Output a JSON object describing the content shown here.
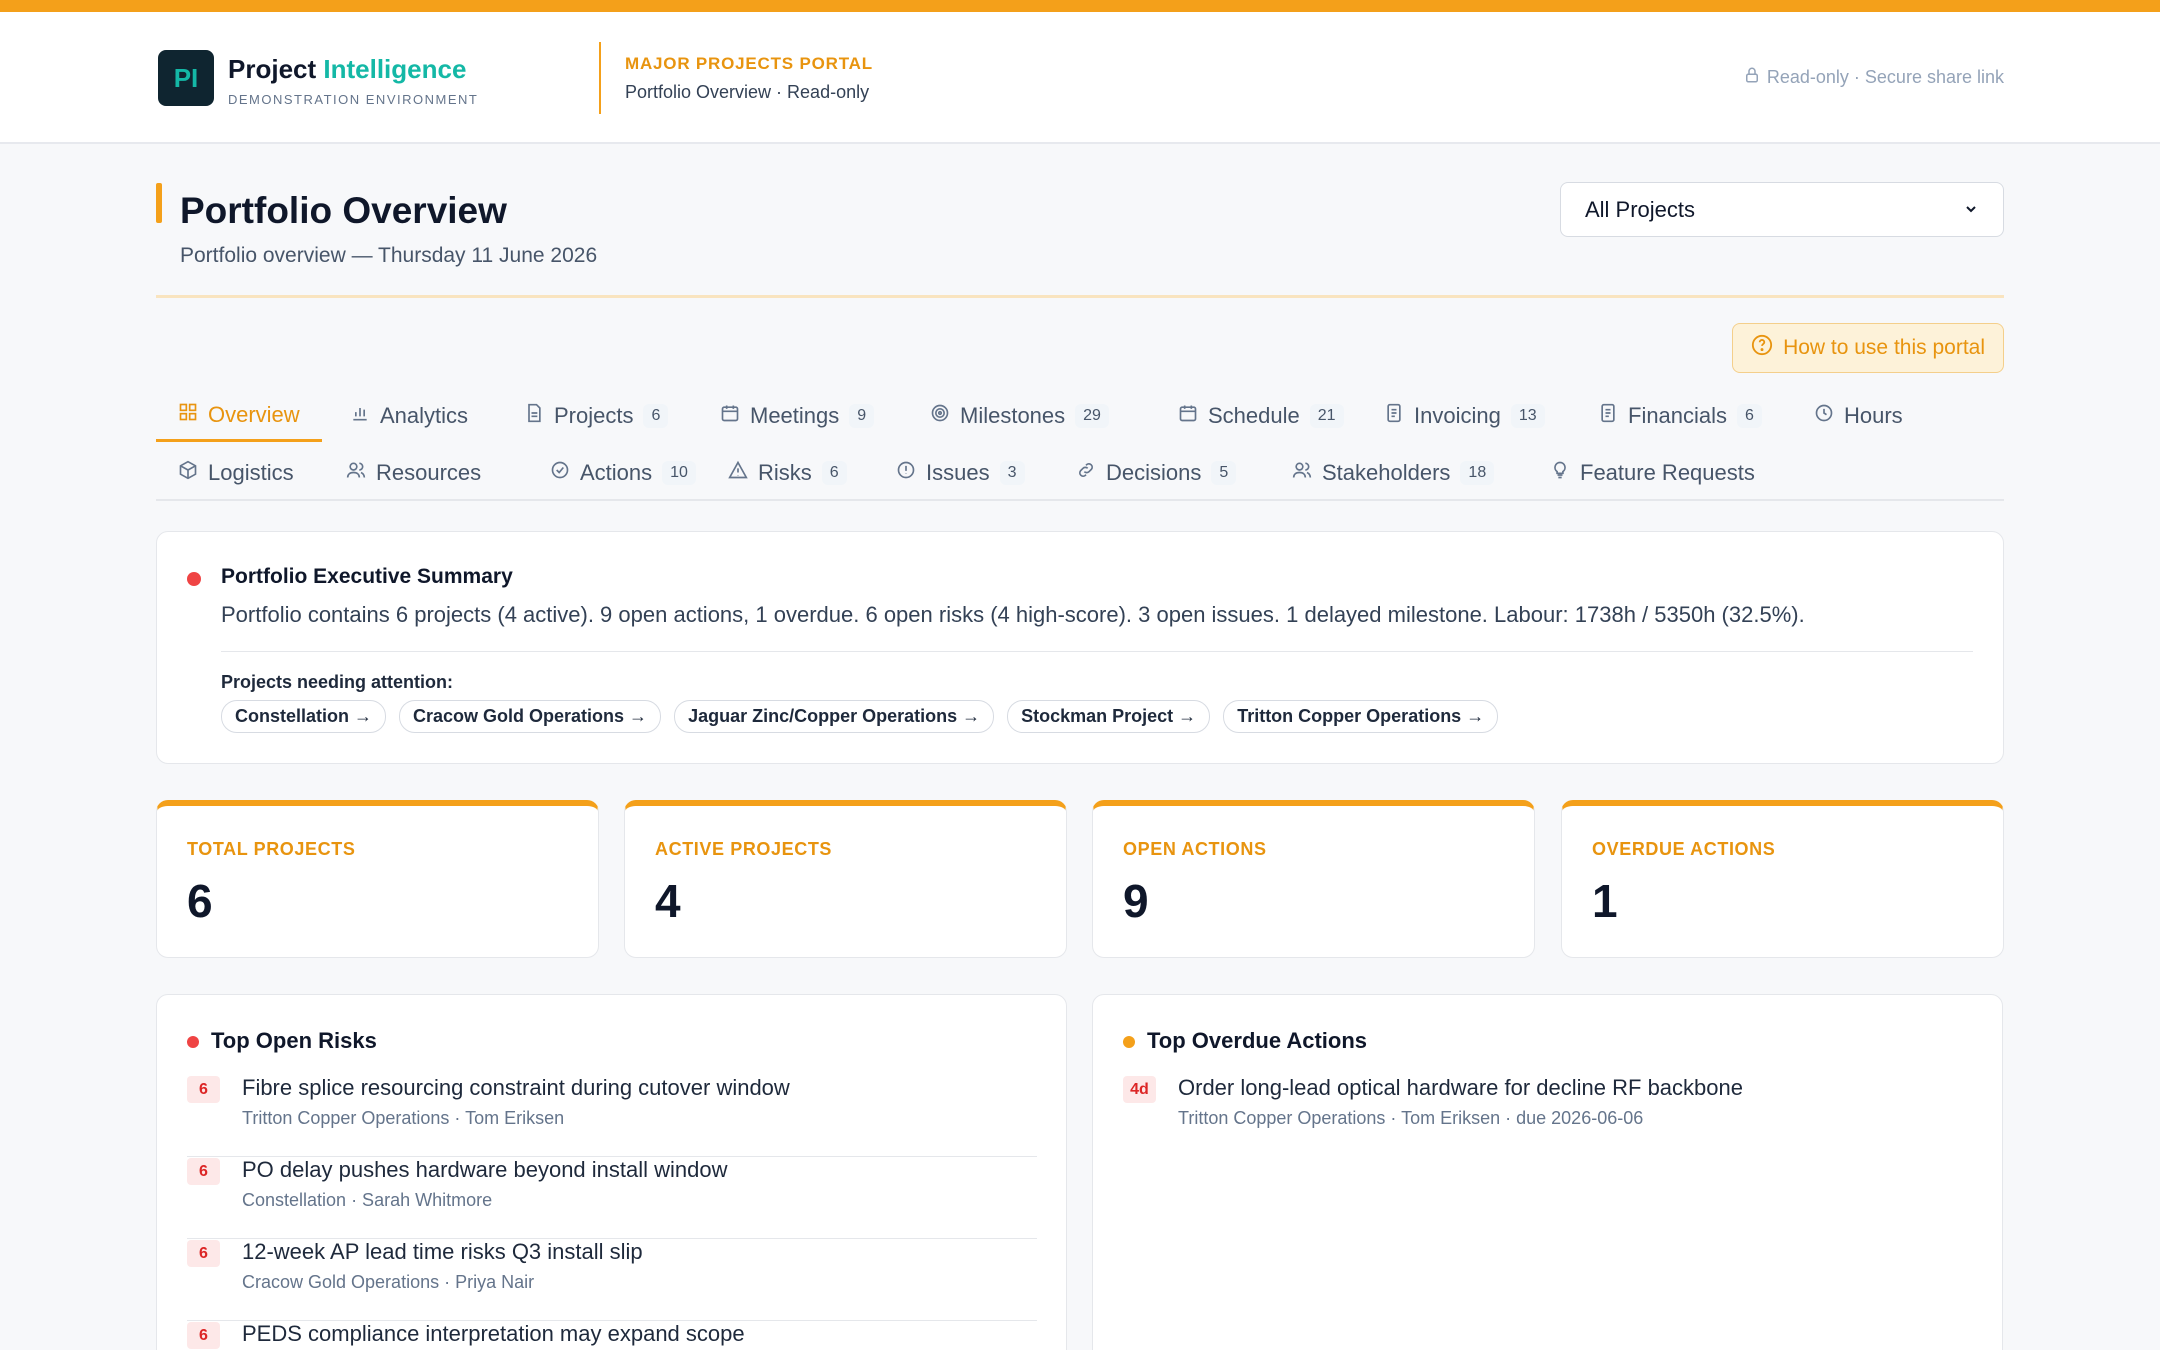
{
  "header": {
    "logo_initials": "PI",
    "brand_word1": "Project",
    "brand_word2": "Intelligence",
    "brand_subtitle": "DEMONSTRATION ENVIRONMENT",
    "portal_label": "MAJOR PROJECTS PORTAL",
    "portal_subtitle": "Portfolio Overview · Read-only",
    "share_text": "Read-only · Secure share link",
    "share_icon": "lock-icon"
  },
  "colors": {
    "accent": "#f4a01a",
    "brand_teal": "#14b8a6",
    "danger": "#ef4444"
  },
  "page": {
    "title": "Portfolio Overview",
    "subtitle": "Portfolio overview — Thursday 11 June 2026",
    "project_filter": "All Projects",
    "help_button": "How to use this portal"
  },
  "tabs_row1": [
    {
      "label": "Overview",
      "icon": "grid-icon",
      "count": "",
      "active": true
    },
    {
      "label": "Analytics",
      "icon": "bar-chart-icon",
      "count": ""
    },
    {
      "label": "Projects",
      "icon": "document-icon",
      "count": "6"
    },
    {
      "label": "Meetings",
      "icon": "calendar-icon",
      "count": "9"
    },
    {
      "label": "Milestones",
      "icon": "target-icon",
      "count": "29"
    },
    {
      "label": "Schedule",
      "icon": "calendar-icon",
      "count": "21"
    },
    {
      "label": "Invoicing",
      "icon": "receipt-icon",
      "count": "13"
    },
    {
      "label": "Financials",
      "icon": "receipt-icon",
      "count": "6"
    },
    {
      "label": "Hours",
      "icon": "clock-icon",
      "count": ""
    }
  ],
  "tabs_row2": [
    {
      "label": "Logistics",
      "icon": "box-icon",
      "count": ""
    },
    {
      "label": "Resources",
      "icon": "users-icon",
      "count": ""
    },
    {
      "label": "Actions",
      "icon": "check-circle-icon",
      "count": "10"
    },
    {
      "label": "Risks",
      "icon": "warning-icon",
      "count": "6"
    },
    {
      "label": "Issues",
      "icon": "info-icon",
      "count": "3"
    },
    {
      "label": "Decisions",
      "icon": "link-icon",
      "count": "5"
    },
    {
      "label": "Stakeholders",
      "icon": "users-icon",
      "count": "18"
    },
    {
      "label": "Feature Requests",
      "icon": "lightbulb-icon",
      "count": ""
    }
  ],
  "summary": {
    "title": "Portfolio Executive Summary",
    "text": "Portfolio contains 6 projects (4 active). 9 open actions, 1 overdue. 6 open risks (4 high-score). 3 open issues. 1 delayed milestone. Labour: 1738h / 5350h (32.5%).",
    "attention_label": "Projects needing attention:",
    "attention_projects": [
      "Constellation →",
      "Cracow Gold Operations →",
      "Jaguar Zinc/Copper Operations →",
      "Stockman Project →",
      "Tritton Copper Operations →"
    ]
  },
  "kpis": [
    {
      "label": "TOTAL PROJECTS",
      "value": "6"
    },
    {
      "label": "ACTIVE PROJECTS",
      "value": "4"
    },
    {
      "label": "OPEN ACTIONS",
      "value": "9"
    },
    {
      "label": "OVERDUE ACTIONS",
      "value": "1"
    }
  ],
  "top_risks": {
    "title": "Top Open Risks",
    "items": [
      {
        "score": "6",
        "title": "Fibre splice resourcing constraint during cutover window",
        "meta": "Tritton Copper Operations · Tom Eriksen"
      },
      {
        "score": "6",
        "title": "PO delay pushes hardware beyond install window",
        "meta": "Constellation · Sarah Whitmore"
      },
      {
        "score": "6",
        "title": "12-week AP lead time risks Q3 install slip",
        "meta": "Cracow Gold Operations · Priya Nair"
      },
      {
        "score": "6",
        "title": "PEDS compliance interpretation may expand scope",
        "meta": ""
      }
    ]
  },
  "overdue_actions": {
    "title": "Top Overdue Actions",
    "items": [
      {
        "days": "4d",
        "title": "Order long-lead optical hardware for decline RF backbone",
        "meta": "Tritton Copper Operations · Tom Eriksen · due 2026-06-06"
      }
    ]
  }
}
